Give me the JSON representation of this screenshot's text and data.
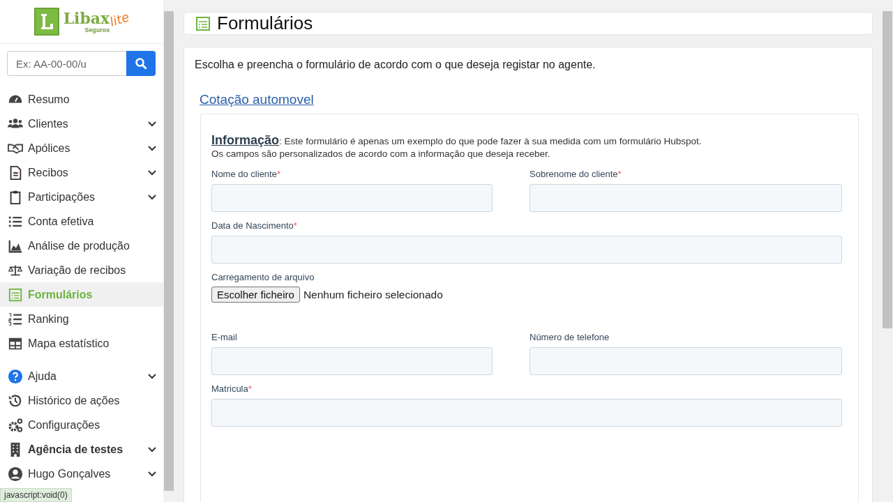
{
  "logo": {
    "name": "Libax",
    "tagline": "Seguros",
    "edition": "lite"
  },
  "search": {
    "placeholder": "Ex: AA-00-00/u"
  },
  "nav": {
    "main_items": [
      {
        "label": "Resumo",
        "expandable": false,
        "selected": false,
        "strong": false
      },
      {
        "label": "Clientes",
        "expandable": true,
        "selected": false,
        "strong": false
      },
      {
        "label": "Apólices",
        "expandable": true,
        "selected": false,
        "strong": false
      },
      {
        "label": "Recibos",
        "expandable": true,
        "selected": false,
        "strong": false
      },
      {
        "label": "Participações",
        "expandable": true,
        "selected": false,
        "strong": false
      },
      {
        "label": "Conta efetiva",
        "expandable": false,
        "selected": false,
        "strong": false
      },
      {
        "label": "Análise de produção",
        "expandable": false,
        "selected": false,
        "strong": false
      },
      {
        "label": "Variação de recibos",
        "expandable": false,
        "selected": false,
        "strong": false
      },
      {
        "label": "Formulários",
        "expandable": false,
        "selected": true,
        "strong": false
      },
      {
        "label": "Ranking",
        "expandable": false,
        "selected": false,
        "strong": false
      },
      {
        "label": "Mapa estatístico",
        "expandable": false,
        "selected": false,
        "strong": false
      }
    ],
    "footer_items": [
      {
        "label": "Ajuda",
        "expandable": true,
        "selected": false,
        "strong": false
      },
      {
        "label": "Histórico de ações",
        "expandable": false,
        "selected": false,
        "strong": false
      },
      {
        "label": "Configurações",
        "expandable": false,
        "selected": false,
        "strong": false
      },
      {
        "label": "Agência de testes",
        "expandable": true,
        "selected": false,
        "strong": true
      },
      {
        "label": "Hugo Gonçalves",
        "expandable": true,
        "selected": false,
        "strong": false
      }
    ]
  },
  "status_bar": "javascript:void(0)",
  "page_title": "Formulários",
  "intro": "Escolha e preencha o formulário de acordo com o que deseja registar no agente.",
  "form_link": "Cotação automovel",
  "form": {
    "heading": "Informação",
    "description": ": Este formulário é apenas um exemplo do que pode fazer à sua medida com um formulário Hubspot.",
    "description_2": "Os campos são personalizados de acordo com a informação que deseja receber.",
    "rows": [
      [
        {
          "kind": "text",
          "label": "Nome do cliente",
          "required_mark": "*"
        },
        {
          "kind": "text",
          "label": "Sobrenome do cliente",
          "required_mark": "*"
        }
      ],
      [
        {
          "kind": "text",
          "label": "Data de Nascimento",
          "required_mark": "*"
        }
      ],
      [
        {
          "kind": "file",
          "label": "Carregamento de arquivo",
          "button": "Escolher ficheiro",
          "value": "Nenhum ficheiro selecionado"
        }
      ],
      [
        {
          "kind": "text",
          "label": "E-mail"
        },
        {
          "kind": "text",
          "label": "Número de telefone"
        }
      ],
      [
        {
          "kind": "text",
          "label": "Matricula",
          "required_mark": "*"
        }
      ]
    ]
  }
}
